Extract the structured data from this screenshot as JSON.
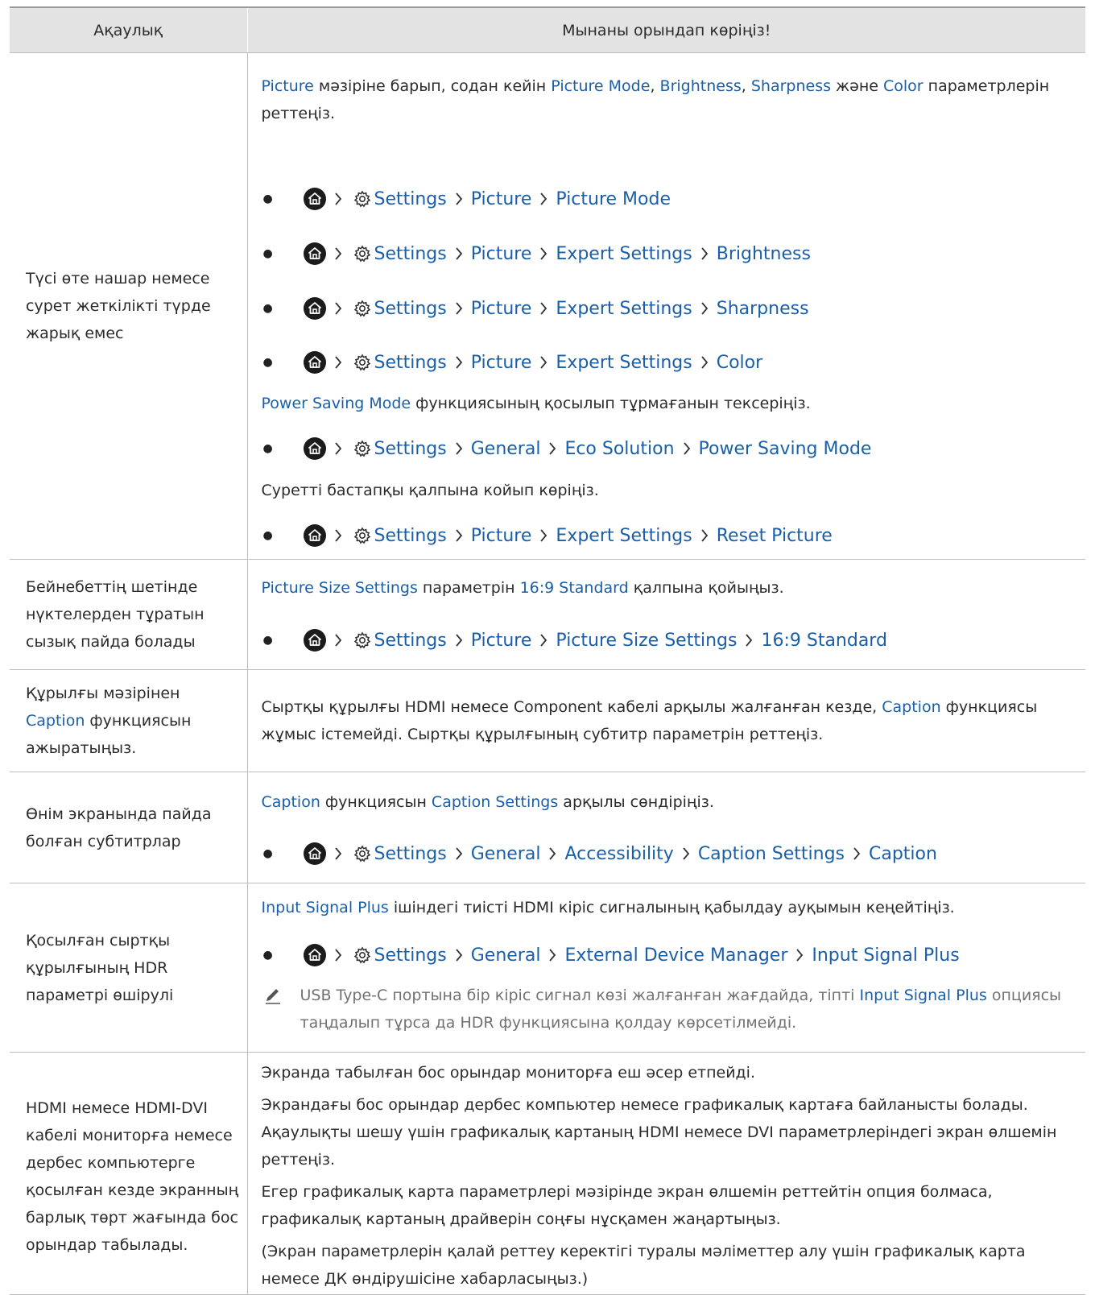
{
  "header": {
    "col1": "Ақаулық",
    "col2": "Мынаны орындап көріңіз!"
  },
  "icons": {
    "home": "home-icon",
    "settings": "gear-icon",
    "chevron": "chevron-right-icon",
    "note": "pencil-note-icon",
    "bullet": "bullet-icon"
  },
  "colors": {
    "link": "#1a5fa8",
    "header_bg": "#e3e3e3",
    "note_text": "#727272"
  },
  "rows": {
    "r1": {
      "problem": "Түсі өте нашар немесе сурет жеткілікті түрде жарық емес",
      "line1": {
        "a": "Picture",
        "b": " мәзіріне барып, содан кейін ",
        "c": "Picture Mode",
        "d": ", ",
        "e": "Brightness",
        "f": ", ",
        "g": "Sharpness",
        "h": " және ",
        "i": "Color",
        "j": " параметрлерін реттеңіз."
      },
      "path1": {
        "p1": "Settings",
        "p2": "Picture",
        "p3": "Picture Mode"
      },
      "path2": {
        "p1": "Settings",
        "p2": "Picture",
        "p3": "Expert Settings",
        "p4": "Brightness"
      },
      "path3": {
        "p1": "Settings",
        "p2": "Picture",
        "p3": "Expert Settings",
        "p4": "Sharpness"
      },
      "path4": {
        "p1": "Settings",
        "p2": "Picture",
        "p3": "Expert Settings",
        "p4": "Color"
      },
      "line2": {
        "a": "Power Saving Mode",
        "b": " функциясының қосылып тұрмағанын тексеріңіз."
      },
      "path5": {
        "p1": "Settings",
        "p2": "General",
        "p3": "Eco Solution",
        "p4": "Power Saving Mode"
      },
      "line3": "Суретті бастапқы қалпына койып көріңіз.",
      "path6": {
        "p1": "Settings",
        "p2": "Picture",
        "p3": "Expert Settings",
        "p4": "Reset Picture"
      }
    },
    "r2": {
      "problem": "Бейнебеттің шетінде нүктелерден тұратын сызық пайда болады",
      "line1": {
        "a": "Picture Size Settings",
        "b": " параметрін ",
        "c": "16:9 Standard",
        "d": " қалпына қойыңыз."
      },
      "path1": {
        "p1": "Settings",
        "p2": "Picture",
        "p3": "Picture Size Settings",
        "p4": "16:9 Standard"
      }
    },
    "r3": {
      "problem_a": "Құрылғы мәзірінен ",
      "problem_b": "Caption",
      "problem_c": " функциясын ажыратыңыз.",
      "line1": {
        "a": "Сыртқы құрылғы HDMI немесе Component кабелі арқылы жалғанған кезде, ",
        "b": "Caption",
        "c": " функциясы жұмыс істемейді. Сыртқы құрылғының субтитр параметрін реттеңіз."
      }
    },
    "r4": {
      "problem": "Өнім экранында пайда болған субтитрлар",
      "line1": {
        "a": "Caption",
        "b": " функциясын ",
        "c": "Caption Settings",
        "d": " арқылы сөндіріңіз."
      },
      "path1": {
        "p1": "Settings",
        "p2": "General",
        "p3": "Accessibility",
        "p4": "Caption Settings",
        "p5": "Caption"
      }
    },
    "r5": {
      "problem": "Қосылған сыртқы құрылғының HDR параметрі өшірулі",
      "line1": {
        "a": "Input Signal Plus",
        "b": " ішіндегі тиісті HDMI кіріс сигналының қабылдау ауқымын кеңейтіңіз."
      },
      "path1": {
        "p1": "Settings",
        "p2": "General",
        "p3": "External Device Manager",
        "p4": "Input Signal Plus"
      },
      "note": {
        "a": "USB Type-C портына бір кіріс сигнал көзі жалғанған жағдайда, тіпті ",
        "b": "Input Signal Plus",
        "c": " опциясы таңдалып тұрса да HDR функциясына қолдау көрсетілмейді."
      }
    },
    "r6": {
      "problem": "HDMI немесе HDMI-DVI кабелі мониторға немесе дербес компьютерге қосылған кезде экранның барлық төрт жағында бос орындар табылады.",
      "t1": "Экранда табылған бос орындар мониторға еш әсер етпейді.",
      "t2": "Экрандағы бос орындар дербес компьютер немесе графикалық картаға байланысты болады. Ақаулықты шешу үшін графикалық картаның HDMI немесе DVI параметрлеріндегі экран өлшемін реттеңіз.",
      "t3": "Егер графикалық карта параметрлері мәзірінде экран өлшемін реттейтін опция болмаса, графикалық картаның драйверін соңғы нұсқамен жаңартыңыз.",
      "t4": "(Экран параметрлерін қалай реттеу керектігі туралы мәліметтер алу үшін графикалық карта немесе ДК өндірушісіне хабарласыңыз.)"
    }
  }
}
